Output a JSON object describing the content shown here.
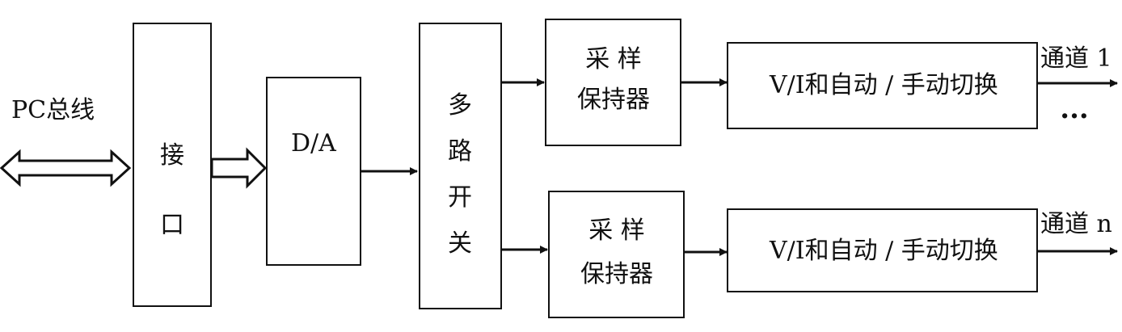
{
  "labels": {
    "pc_bus": "PC总线",
    "interface": "接口",
    "da": "D/A",
    "mux": "多路开关",
    "sh_top_line1": "采 样",
    "sh_top_line2": "保持器",
    "sh_bottom_line1": "采 样",
    "sh_bottom_line2": "保持器",
    "vi_top": "V/I和自动 / 手动切换",
    "vi_bottom": "V/I和自动 / 手动切换",
    "channel_1": "通道 1",
    "channel_n": "通道 n",
    "ellipsis": "···"
  },
  "colors": {
    "stroke": "#111111",
    "background": "#ffffff"
  }
}
